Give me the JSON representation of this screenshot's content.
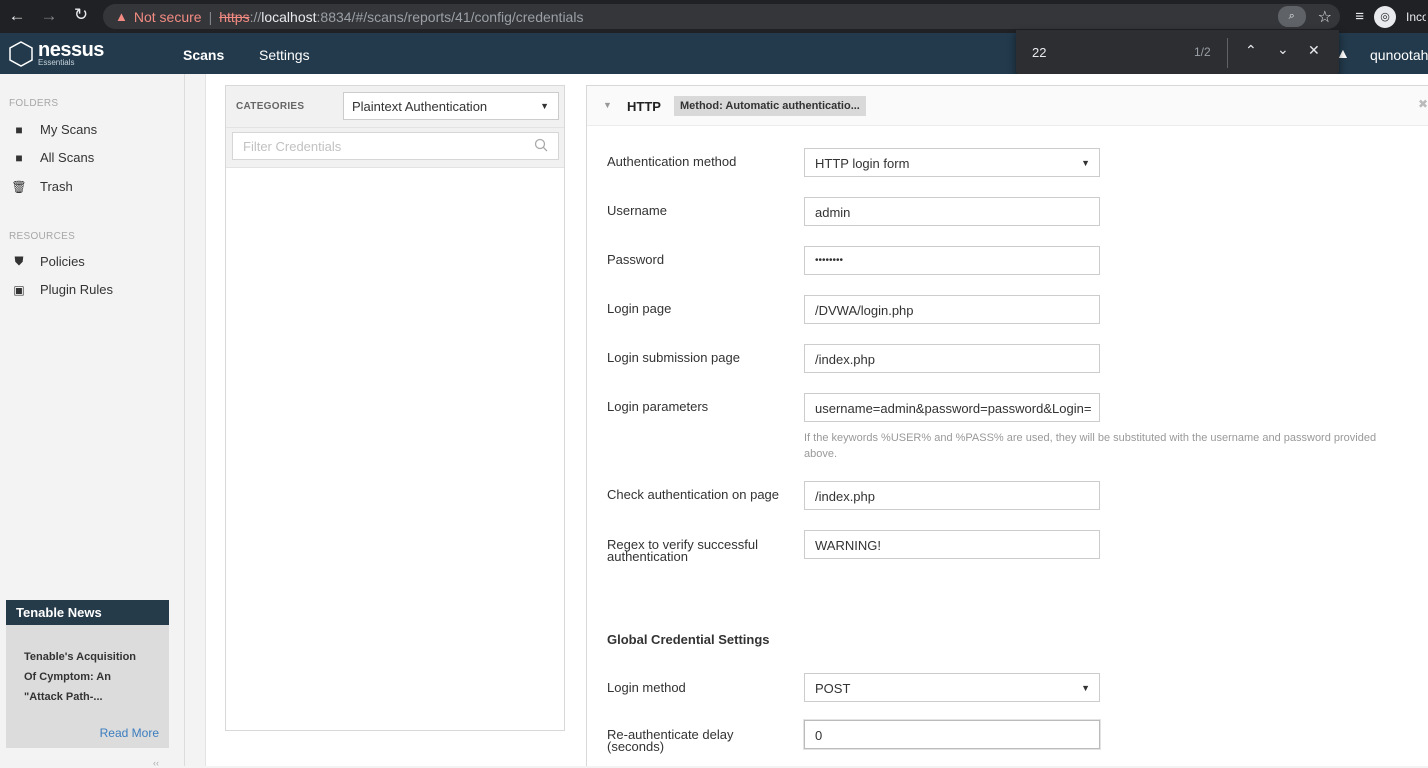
{
  "browser": {
    "not_secure": "Not secure",
    "url_scheme": "https",
    "url_scheme_sep": "://",
    "url_host": "localhost",
    "url_rest": ":8834/#/scans/reports/41/config/credentials",
    "incognito_label": "Incognito"
  },
  "find": {
    "query": "22",
    "count": "1/2"
  },
  "header": {
    "logo_name": "nessus",
    "logo_sub": "Essentials",
    "tabs": [
      "Scans",
      "Settings"
    ],
    "username": "qunootah"
  },
  "sidebar": {
    "folders_label": "FOLDERS",
    "folders": [
      "My Scans",
      "All Scans",
      "Trash"
    ],
    "resources_label": "RESOURCES",
    "resources": [
      "Policies",
      "Plugin Rules"
    ],
    "news_title": "Tenable News",
    "news_body": "Tenable's Acquisition Of Cymptom: An \"Attack Path-...",
    "news_link": "Read More"
  },
  "categories": {
    "label": "CATEGORIES",
    "selected": "Plaintext Authentication",
    "filter_placeholder": "Filter Credentials"
  },
  "http": {
    "title": "HTTP",
    "method_chip": "Method: Automatic authenticatio...",
    "fields": {
      "auth_method_label": "Authentication method",
      "auth_method_value": "HTTP login form",
      "username_label": "Username",
      "username_value": "admin",
      "password_label": "Password",
      "password_value": "••••••••",
      "login_page_label": "Login page",
      "login_page_value": "/DVWA/login.php",
      "login_submit_label": "Login submission page",
      "login_submit_value": "/index.php",
      "login_params_label": "Login parameters",
      "login_params_value": "username=admin&password=password&Login=",
      "login_params_help": "If the keywords %USER% and %PASS% are used, they will be substituted with the username and password provided above.",
      "check_auth_label": "Check authentication on page",
      "check_auth_value": "/index.php",
      "regex_label": "Regex to verify successful authentication",
      "regex_value": "WARNING!"
    },
    "global_title": "Global Credential Settings",
    "login_method_label": "Login method",
    "login_method_value": "POST",
    "reauth_label": "Re-authenticate delay (seconds)",
    "reauth_value": "0"
  }
}
